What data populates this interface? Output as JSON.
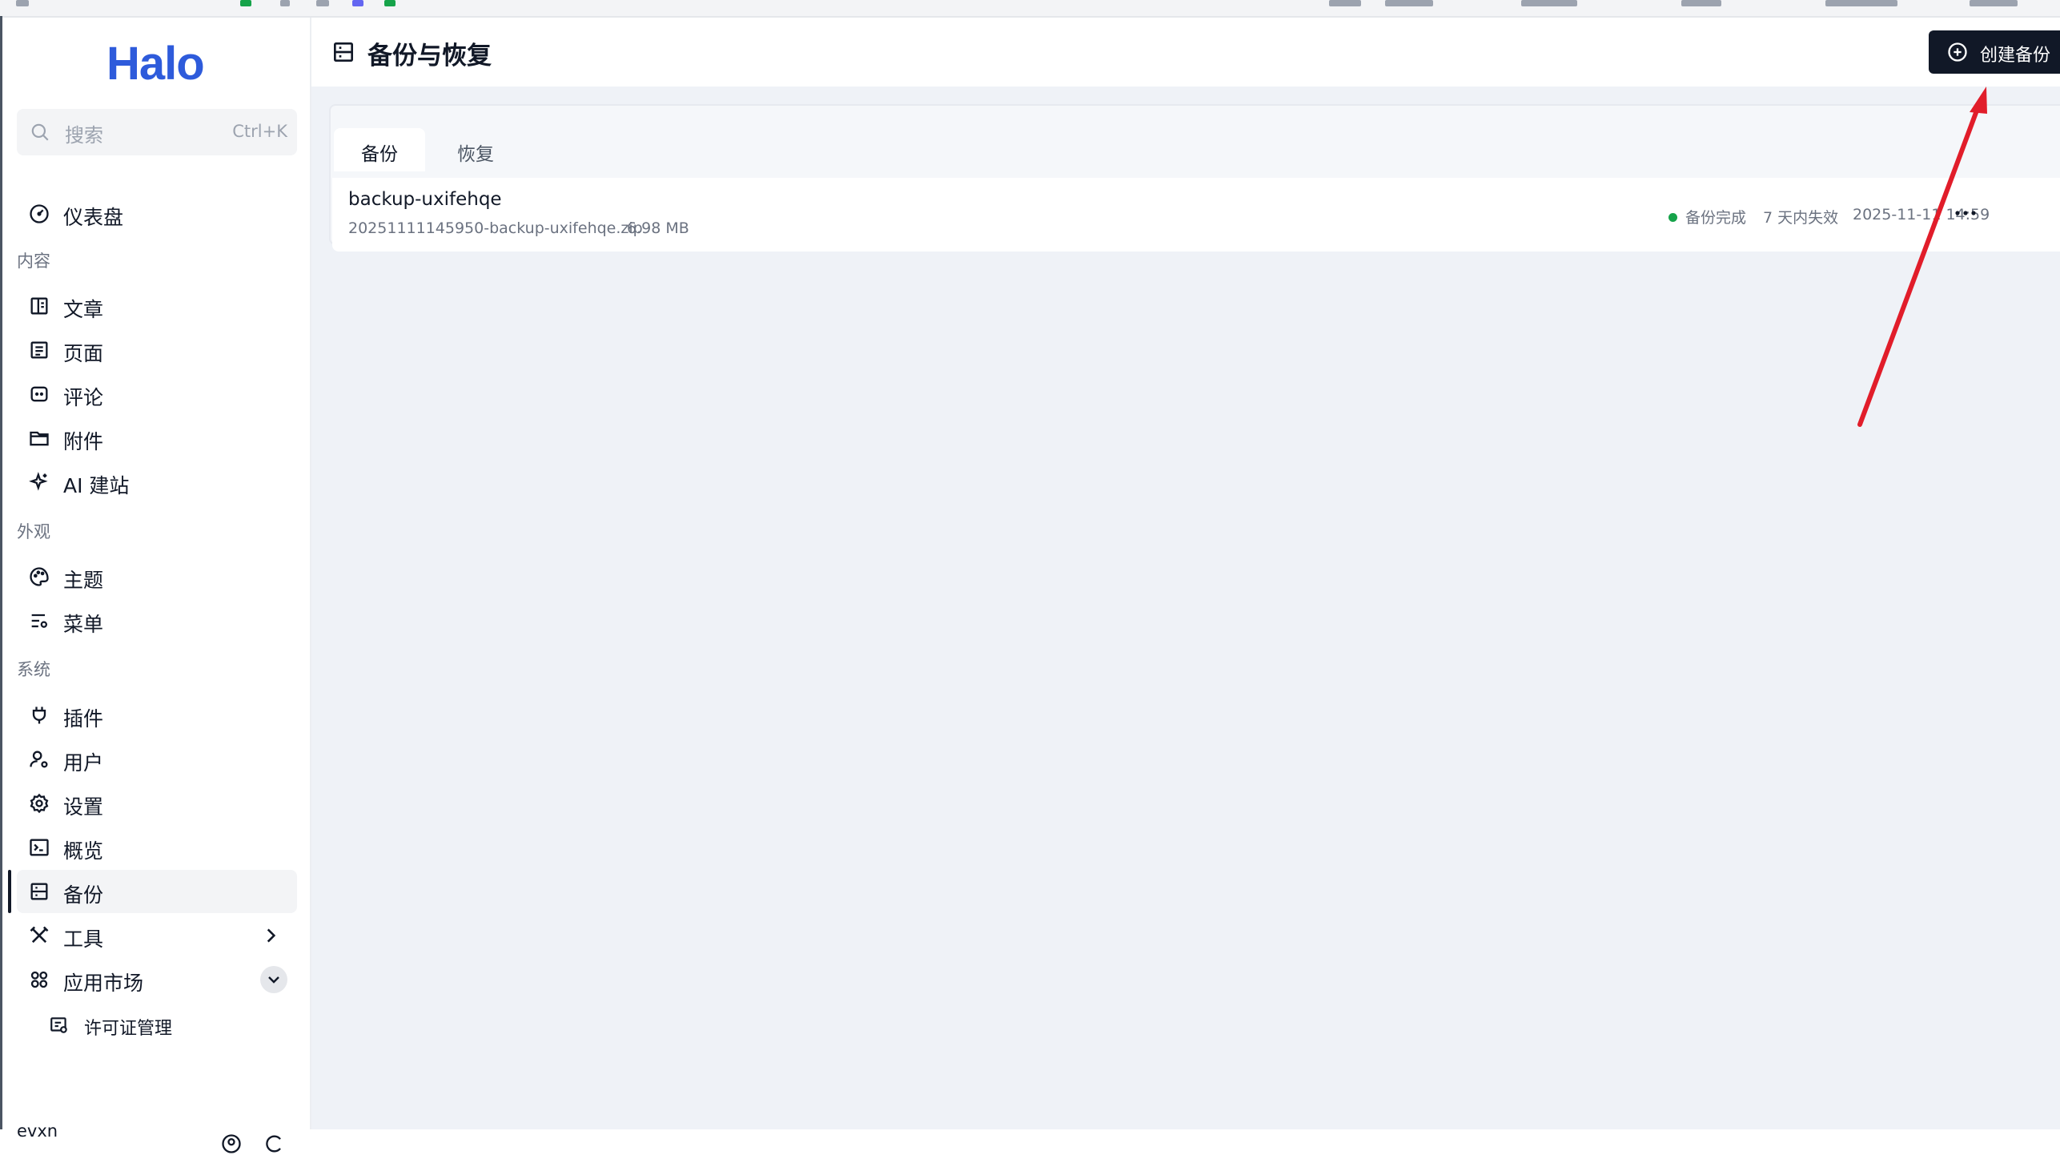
{
  "app": {
    "logo_text": "Halo"
  },
  "search": {
    "placeholder": "搜索",
    "shortcut": "Ctrl+K"
  },
  "sidebar": {
    "dashboard": {
      "label": "仪表盘",
      "icon": "dashboard-icon"
    },
    "groups": {
      "content": "内容",
      "appearance": "外观",
      "system": "系统"
    },
    "content_items": [
      {
        "label": "文章",
        "icon": "posts-icon"
      },
      {
        "label": "页面",
        "icon": "pages-icon"
      },
      {
        "label": "评论",
        "icon": "comments-icon"
      },
      {
        "label": "附件",
        "icon": "folder-icon"
      },
      {
        "label": "AI 建站",
        "icon": "sparkles-icon"
      }
    ],
    "appearance_items": [
      {
        "label": "主题",
        "icon": "palette-icon"
      },
      {
        "label": "菜单",
        "icon": "menu-settings-icon"
      }
    ],
    "system_items": [
      {
        "label": "插件",
        "icon": "plug-icon"
      },
      {
        "label": "用户",
        "icon": "user-settings-icon"
      },
      {
        "label": "设置",
        "icon": "gear-icon"
      },
      {
        "label": "概览",
        "icon": "terminal-icon"
      },
      {
        "label": "备份",
        "icon": "backup-icon",
        "active": true
      },
      {
        "label": "工具",
        "icon": "tools-icon"
      },
      {
        "label": "应用市场",
        "icon": "apps-grid-icon"
      }
    ],
    "sub_items": [
      {
        "label": "许可证管理",
        "icon": "license-icon"
      }
    ],
    "user": {
      "name": "evxn"
    }
  },
  "header": {
    "title": "备份与恢复",
    "create_button": "创建备份"
  },
  "tabs": [
    {
      "label": "备份",
      "active": true
    },
    {
      "label": "恢复",
      "active": false
    }
  ],
  "backups": [
    {
      "name": "backup-uxifehqe",
      "file": "20251111145950-backup-uxifehqe.zip",
      "size": "6.98 MB",
      "status": "备份完成",
      "expire": "7 天内失效",
      "time": "2025-11-11 14:59"
    }
  ],
  "colors": {
    "brand": "#2e5bdb",
    "status_ok": "#16a34a",
    "annotation": "#e11d2a",
    "button": "#111827"
  }
}
